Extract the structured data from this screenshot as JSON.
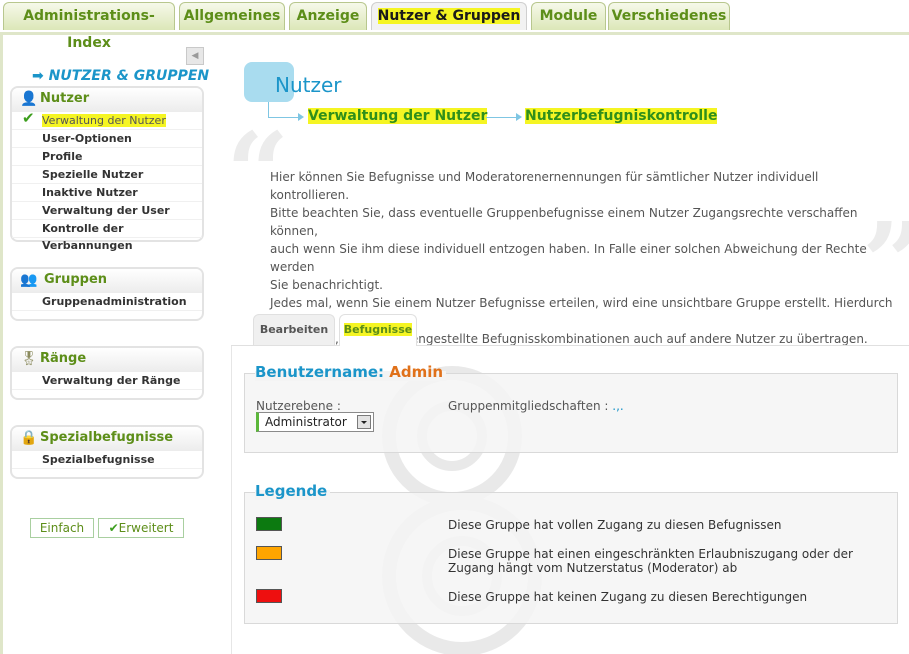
{
  "top_tabs": [
    "Administrations-Index",
    "Allgemeines",
    "Anzeige",
    "Nutzer & Gruppen",
    "Module",
    "Verschiedenes"
  ],
  "active_top_tab": "Nutzer & Gruppen",
  "sidebar": {
    "section_title": "NUTZER & GRUPPEN",
    "boxes": [
      {
        "title": "Nutzer",
        "items": [
          "Verwaltung der Nutzer",
          "User-Optionen",
          "Profile",
          "Spezielle Nutzer",
          "Inaktive Nutzer",
          "Verwaltung der User",
          "Kontrolle der Verbannungen"
        ]
      },
      {
        "title": "Gruppen",
        "items": [
          "Gruppenadministration"
        ]
      },
      {
        "title": "Ränge",
        "items": [
          "Verwaltung der Ränge"
        ]
      },
      {
        "title": "Spezialbefugnisse",
        "items": [
          "Spezialbefugnisse"
        ]
      }
    ],
    "active_item": "Verwaltung der Nutzer",
    "mode_buttons": [
      "Einfach",
      "Erweitert"
    ]
  },
  "page": {
    "title": "Nutzer",
    "breadcrumb": [
      "Verwaltung der Nutzer",
      "Nutzerbefugniskontrolle"
    ],
    "description_lines": [
      "Hier können Sie Befugnisse und Moderatorenernennungen für sämtlicher Nutzer individuell kontrollieren.",
      "Bitte beachten Sie, dass eventuelle Gruppenbefugnisse einem Nutzer Zugangsrechte verschaffen können,",
      "auch wenn Sie ihm diese individuell entzogen haben. In Falle einer solchen Abweichung der Rechte werden",
      "Sie benachrichtigt.",
      "Jedes mal, wenn Sie einem Nutzer Befugnisse erteilen, wird eine unsichtbare Gruppe erstellt. Hierdurch ist",
      "es möglich, so zusammengestellte Befugnisskombinationen auch auf andere Nutzer zu übertragen."
    ]
  },
  "content_tabs": [
    "Bearbeiten",
    "Befugnisse"
  ],
  "active_content_tab": "Befugnisse",
  "user_box": {
    "legend_label": "Benutzername",
    "username": "Admin",
    "level_label": "Nutzerebene :",
    "level_value": "Administrator",
    "groups_label": "Gruppenmitgliedschaften :",
    "groups_value": ".,."
  },
  "legend_box": {
    "title": "Legende",
    "items": [
      {
        "color": "#0c7a10",
        "text": "Diese Gruppe hat vollen Zugang zu diesen Befugnissen"
      },
      {
        "color": "#ffa500",
        "text": "Diese Gruppe hat einen eingeschränkten Erlaubniszugang oder der Zugang hängt vom Nutzerstatus (Moderator) ab"
      },
      {
        "color": "#ee0f0f",
        "text": "Diese Gruppe hat keinen Zugang zu diesen Berechtigungen"
      }
    ]
  },
  "colors": {
    "brand_green": "#5d8e19",
    "accent_blue": "#1b95c9",
    "highlight": "#f5f523",
    "admin_orange": "#e0711a"
  }
}
